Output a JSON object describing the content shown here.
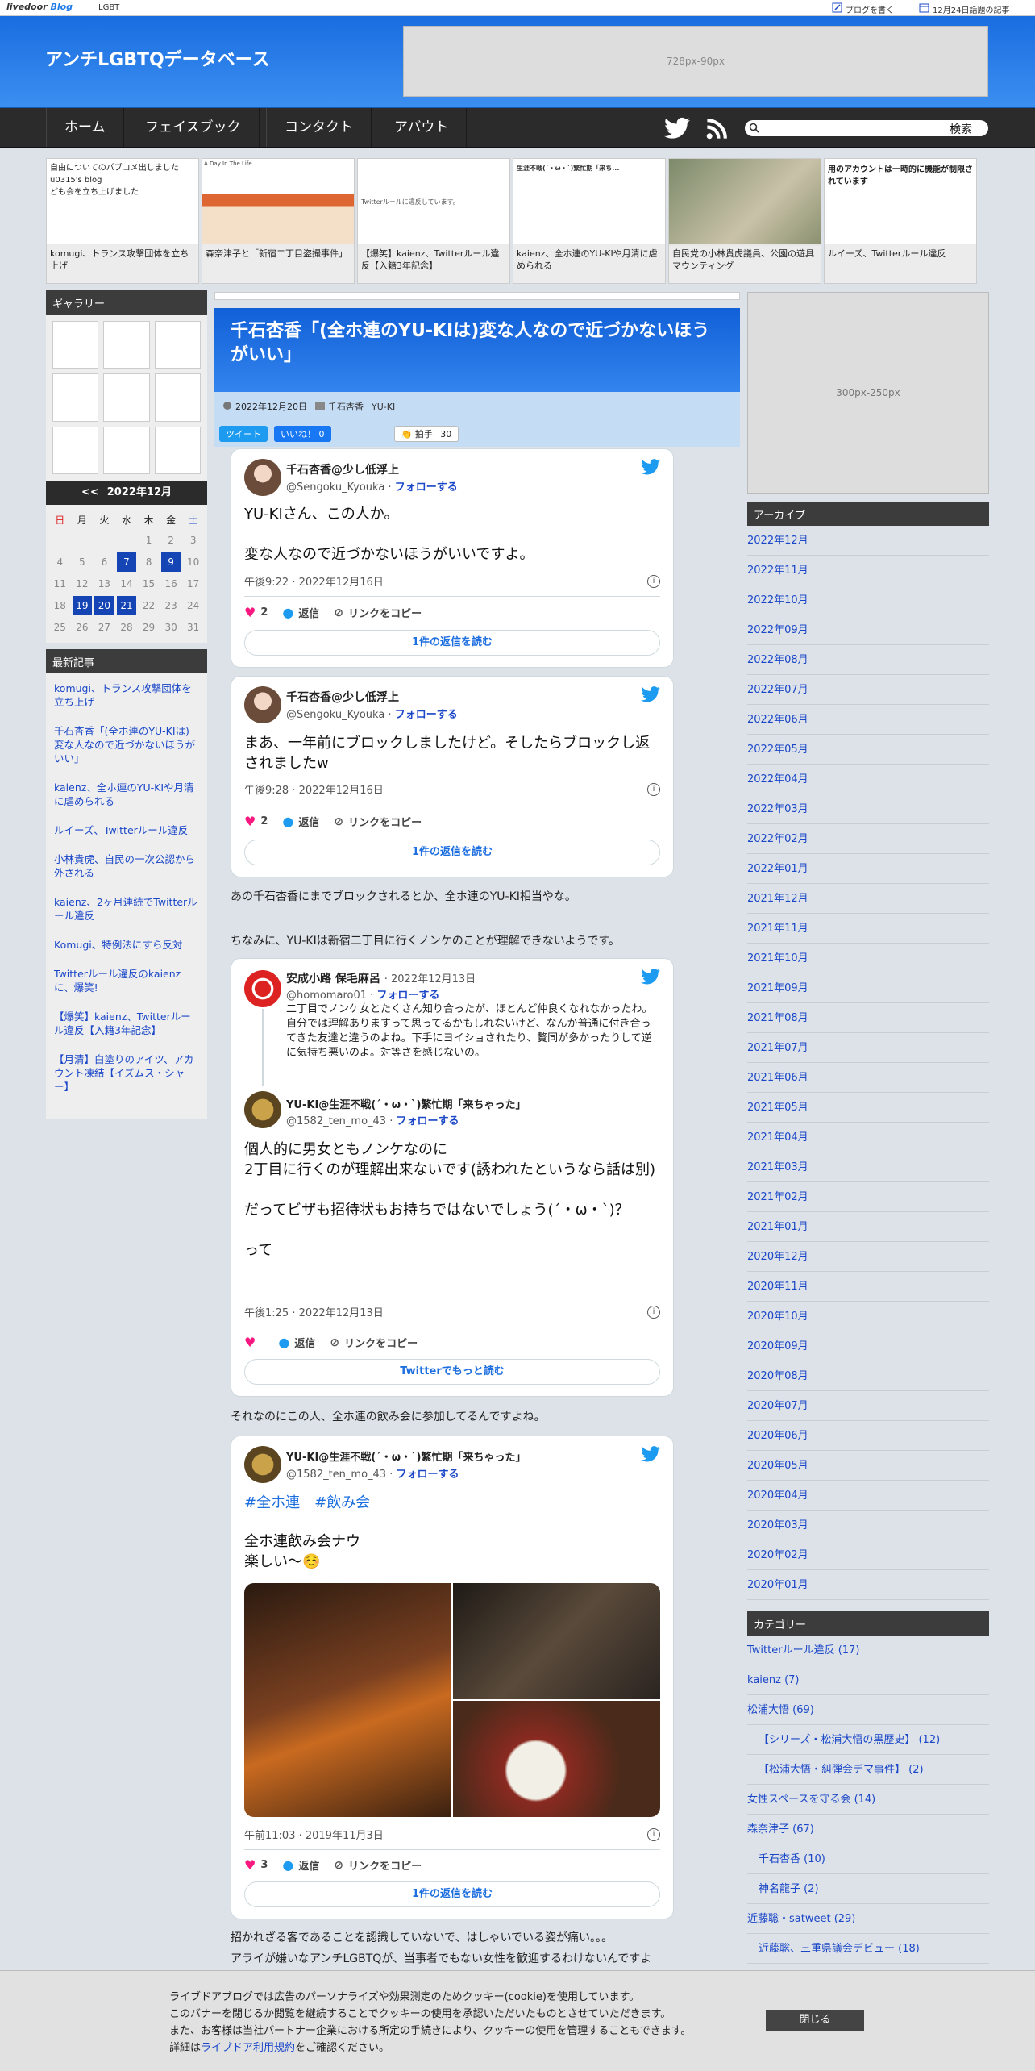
{
  "topbar": {
    "brand_a": "livedoor",
    "brand_b": "Blog",
    "tag": "LGBT",
    "write": "ブログを書く",
    "trending": "12月24日話題の記事"
  },
  "header": {
    "title": "アンチLGBTQデータベース",
    "ad": "728px-90px"
  },
  "nav": {
    "items": [
      "ホーム",
      "フェイスブック",
      "コンタクト",
      "アバウト"
    ],
    "search_placeholder": "",
    "search_button": "検索"
  },
  "strip": [
    {
      "caption": "komugi、トランス攻撃団体を立ち上げ",
      "snippet": "自由についてのパブコメ出しました\nu0315's blog\nども会を立ち上げました"
    },
    {
      "caption": "森奈津子と「新宿二丁目盗撮事件」",
      "snippet": "A Day In The Life"
    },
    {
      "caption": "【爆笑】kaienz、Twitterルール違反【入籍3年記念】",
      "snippet": "Twitterルールに違反しています。"
    },
    {
      "caption": "kaienz、全ホ連のYU-KIや月清に虐められる",
      "snippet": "生涯不戦(´・ω・`)繁忙期「来ち..."
    },
    {
      "caption": "自民党の小林貴虎議員、公園の遊具マウンティング",
      "snippet": ""
    },
    {
      "caption": "ルイーズ、Twitterルール違反",
      "snippet": "用のアカウントは一時的に機能が制限されています"
    }
  ],
  "gallery_label": "ギャラリー",
  "calendar": {
    "prev": "<<",
    "title": "2022年12月",
    "days": [
      "日",
      "月",
      "火",
      "水",
      "木",
      "金",
      "土"
    ],
    "rows": [
      [
        "",
        "",
        "",
        "",
        "1",
        "2",
        "3"
      ],
      [
        "4",
        "5",
        "6",
        "7",
        "8",
        "9",
        "10"
      ],
      [
        "11",
        "12",
        "13",
        "14",
        "15",
        "16",
        "17"
      ],
      [
        "18",
        "19",
        "20",
        "21",
        "22",
        "23",
        "24"
      ],
      [
        "25",
        "26",
        "27",
        "28",
        "29",
        "30",
        "31"
      ]
    ]
  },
  "recent": {
    "label": "最新記事",
    "items": [
      "komugi、トランス攻撃団体を立ち上げ",
      "千石杏香「(全ホ連のYU-KIは)変な人なので近づかないほうがいい」",
      "kaienz、全ホ連のYU-KIや月清に虐められる",
      "ルイーズ、Twitterルール違反",
      "小林貴虎、自民の一次公認から外される",
      "kaienz、2ヶ月連続でTwitterルール違反",
      "Komugi、特例法にすら反対",
      "Twitterルール違反のkaienzに、爆笑!",
      "【爆笑】kaienz、Twitterルール違反【入籍3年記念】",
      "【月清】白塗りのアイツ、アカウント凍結【イズムス・シャー】"
    ]
  },
  "post": {
    "title": "千石杏香「(全ホ連のYU-KIは)変な人なので近づかないほうがいい」",
    "date": "2022年12月20日",
    "cat1": "千石杏香",
    "cat2": "YU-KI",
    "tweet_btn": "ツイート",
    "like_btn": "いいね！ 0",
    "clap": "拍手",
    "clap_count": "30"
  },
  "tweets": [
    {
      "name": "千石杏香@少し低浮上",
      "handle": "@Sengoku_Kyouka",
      "follow": "フォローする",
      "body": "YU-KIさん、この人か。\n\n変な人なので近づかないほうがいいですよ。",
      "time": "午後9:22 · 2022年12月16日",
      "likes": "2",
      "reply": "返信",
      "copy": "リンクをコピー",
      "more": "1件の返信を読む"
    },
    {
      "name": "千石杏香@少し低浮上",
      "handle": "@Sengoku_Kyouka",
      "follow": "フォローする",
      "body": "まあ、一年前にブロックしましたけど。そしたらブロックし返されましたw",
      "time": "午後9:28 · 2022年12月16日",
      "likes": "2",
      "reply": "返信",
      "copy": "リンクをコピー",
      "more": "1件の返信を読む"
    },
    {
      "qname": "安成小路 保毛麻呂",
      "qdate": "· 2022年12月13日",
      "qhandle": "@homomaro01",
      "qtext": "二丁目でノンケ女とたくさん知り合ったが、ほとんど仲良くなれなかったわ。\n自分では理解ありますって思ってるかもしれないけど、なんか普通に付き合ってきた友達と違うのよね。下手にヨイショされたり、贅同が多かったりして逆に気持ち悪いのよ。対等さを感じないの。",
      "name": "YU-KI@生涯不戦(´・ω・`)繁忙期「来ちゃった」",
      "handle": "@1582_ten_mo_43",
      "follow": "フォローする",
      "body": "個人的に男女ともノンケなのに\n2丁目に行くのが理解出来ないです(誘われたというなら話は別)\n\nだってビザも招待状もお持ちではないでしょう(´・ω・`)？\n\nって",
      "time": "午後1:25 · 2022年12月13日",
      "reply": "返信",
      "copy": "リンクをコピー",
      "more": "Twitterでもっと読む"
    },
    {
      "name": "YU-KI@生涯不戦(´・ω・`)繁忙期「来ちゃった」",
      "handle": "@1582_ten_mo_43",
      "follow": "フォローする",
      "tags": "#全ホ連　#飲み会",
      "body": "全ホ連飲み会ナウ\n楽しい～☺️",
      "time": "午前11:03 · 2019年11月3日",
      "likes": "3",
      "reply": "返信",
      "copy": "リンクをコピー",
      "more": "1件の返信を読む"
    }
  ],
  "paragraphs": [
    "あの千石杏香にまでブロックされるとか、全ホ連のYU-KI相当やな。",
    "ちなみに、YU-KIは新宿二丁目に行くノンケのことが理解できないようです。",
    "それなのにこの人、全ホ連の飲み会に参加してるんですよね。",
    "招かれざる客であることを認識していないで、はしゃいでいる姿が痛い。。。",
    "アライが嫌いなアンチLGBTQが、当事者でもない女性を歓迎するわけないんですよ"
  ],
  "right": {
    "ad": "300px-250px",
    "archive_label": "アーカイブ",
    "archives": [
      "2022年12月",
      "2022年11月",
      "2022年10月",
      "2022年09月",
      "2022年08月",
      "2022年07月",
      "2022年06月",
      "2022年05月",
      "2022年04月",
      "2022年03月",
      "2022年02月",
      "2022年01月",
      "2021年12月",
      "2021年11月",
      "2021年10月",
      "2021年09月",
      "2021年08月",
      "2021年07月",
      "2021年06月",
      "2021年05月",
      "2021年04月",
      "2021年03月",
      "2021年02月",
      "2021年01月",
      "2020年12月",
      "2020年11月",
      "2020年10月",
      "2020年09月",
      "2020年08月",
      "2020年07月",
      "2020年06月",
      "2020年05月",
      "2020年04月",
      "2020年03月",
      "2020年02月",
      "2020年01月"
    ],
    "category_label": "カテゴリー",
    "categories": [
      {
        "t": "Twitterルール違反 (17)",
        "s": false
      },
      {
        "t": "kaienz (7)",
        "s": false
      },
      {
        "t": "松浦大悟 (69)",
        "s": false
      },
      {
        "t": "【シリーズ・松浦大悟の黒歴史】 (12)",
        "s": true
      },
      {
        "t": "【松浦大悟・糾弾会デマ事件】 (2)",
        "s": true
      },
      {
        "t": "女性スペースを守る会 (14)",
        "s": false
      },
      {
        "t": "森奈津子 (67)",
        "s": false
      },
      {
        "t": "千石杏香 (10)",
        "s": true
      },
      {
        "t": "神名龍子 (2)",
        "s": true
      },
      {
        "t": "近藤聡・satweet (29)",
        "s": false
      },
      {
        "t": "近藤聡、三重県議会デビュー (18)",
        "s": true
      }
    ]
  },
  "cookie": {
    "line1": "ライブドアブログでは広告のパーソナライズや効果測定のためクッキー(cookie)を使用しています。",
    "line2": "このバナーを閉じるか閲覧を継続することでクッキーの使用を承認いただいたものとさせていただきます。",
    "line3": "また、お客様は当社パートナー企業における所定の手続きにより、クッキーの使用を管理することもできます。",
    "line4a": "詳細は",
    "line4link": "ライブドア利用規約",
    "line4b": "をご確認ください。",
    "close": "閉じる"
  }
}
